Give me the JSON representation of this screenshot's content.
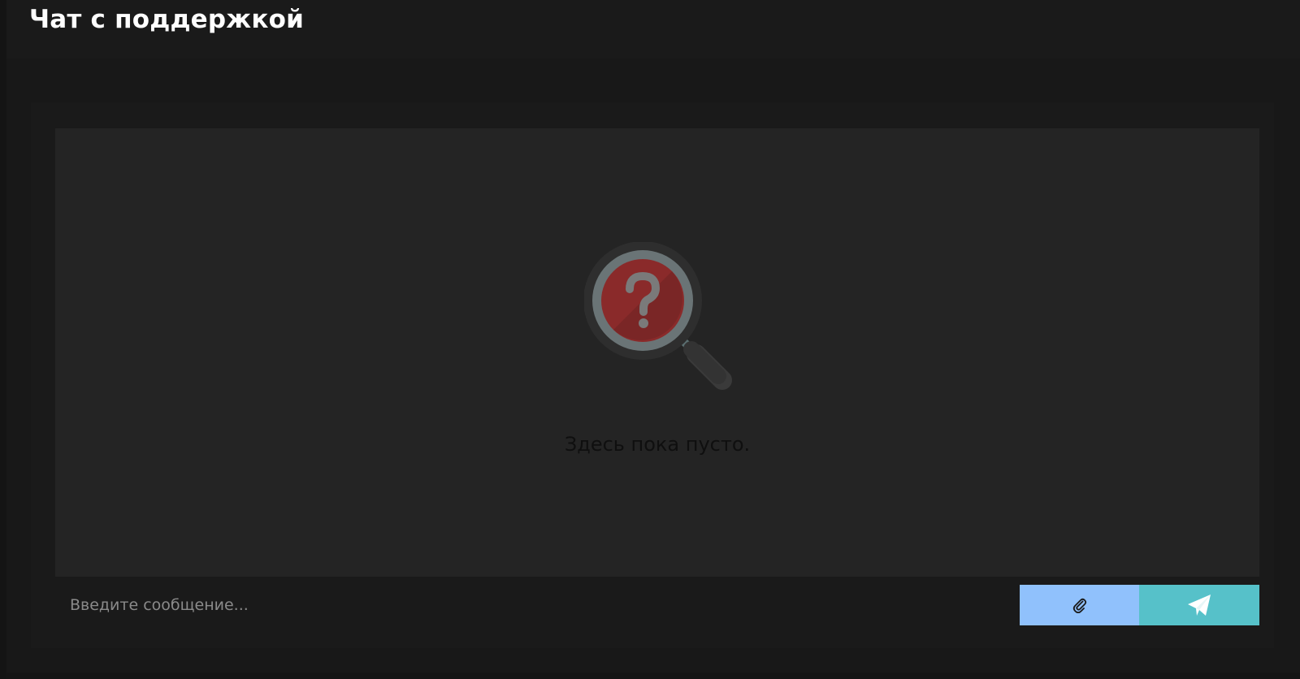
{
  "header": {
    "title": "Чат с поддержкой"
  },
  "chat": {
    "empty_state": {
      "icon": "magnifier-question-icon",
      "text": "Здесь пока пусто."
    },
    "composer": {
      "placeholder": "Введите сообщение...",
      "value": "",
      "attach_icon": "paperclip-icon",
      "send_icon": "paper-plane-icon"
    }
  },
  "colors": {
    "background": "#181818",
    "messages_area": "#242424",
    "attach_button": "#90c1fc",
    "send_button": "#56c1c9",
    "icon_red": "#8a2a2a",
    "title_text": "#ffffff"
  }
}
